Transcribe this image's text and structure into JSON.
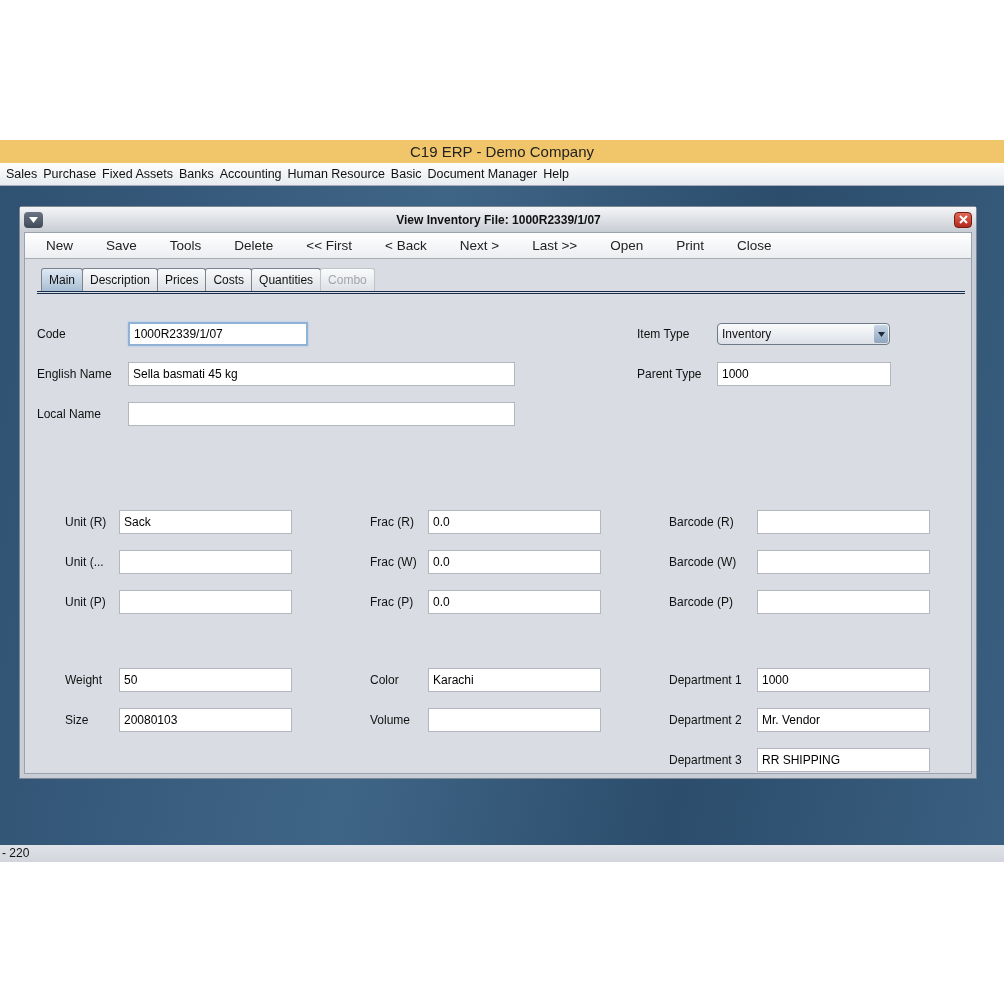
{
  "app": {
    "title": "C19 ERP - Demo Company"
  },
  "menu": [
    "Sales",
    "Purchase",
    "Fixed Assets",
    "Banks",
    "Accounting",
    "Human Resource",
    "Basic",
    "Document Manager",
    "Help"
  ],
  "window": {
    "title": "View Inventory File: 1000R2339/1/07"
  },
  "toolbar": [
    "New",
    "Save",
    "Tools",
    "Delete",
    "<< First",
    "< Back",
    "Next >",
    "Last >>",
    "Open",
    "Print",
    "Close"
  ],
  "tabs": [
    {
      "label": "Main",
      "selected": true,
      "disabled": false
    },
    {
      "label": "Description",
      "selected": false,
      "disabled": false
    },
    {
      "label": "Prices",
      "selected": false,
      "disabled": false
    },
    {
      "label": "Costs",
      "selected": false,
      "disabled": false
    },
    {
      "label": "Quantities",
      "selected": false,
      "disabled": false
    },
    {
      "label": "Combo",
      "selected": false,
      "disabled": true
    }
  ],
  "top_left": [
    {
      "label": "Code",
      "value": "1000R2339/1/07",
      "focused": true
    },
    {
      "label": "English Name",
      "value": "Sella basmati 45 kg",
      "focused": false
    },
    {
      "label": "Local Name",
      "focused": false
    }
  ],
  "top_right": [
    {
      "label": "Item Type",
      "value": "Inventory",
      "kind": "dropdown"
    },
    {
      "label": "Parent Type",
      "value": "1000",
      "kind": "text"
    }
  ],
  "blocks": [
    {
      "columns": [
        [
          {
            "label": "Unit (R)",
            "value": "Sack"
          },
          {
            "label": "Unit (..."
          },
          {
            "label": "Unit (P)"
          }
        ],
        [
          {
            "label": "Frac (R)",
            "value": "0.0"
          },
          {
            "label": "Frac (W)",
            "value": "0.0"
          },
          {
            "label": "Frac (P)",
            "value": "0.0"
          }
        ],
        [
          {
            "label": "Barcode (R)"
          },
          {
            "label": "Barcode (W)"
          },
          {
            "label": "Barcode (P)"
          }
        ]
      ]
    },
    {
      "columns": [
        [
          {
            "label": "Weight",
            "value": "50"
          },
          {
            "label": "Size",
            "value": "20080103"
          }
        ],
        [
          {
            "label": "Color",
            "value": "Karachi"
          },
          {
            "label": "Volume"
          }
        ],
        [
          {
            "label": "Department 1",
            "value": "1000"
          },
          {
            "label": "Department 2",
            "value": "Mr. Vendor"
          },
          {
            "label": "Department 3",
            "value": "RR SHIPPING"
          }
        ]
      ]
    }
  ],
  "status_bar": {
    "text": "- 220"
  }
}
